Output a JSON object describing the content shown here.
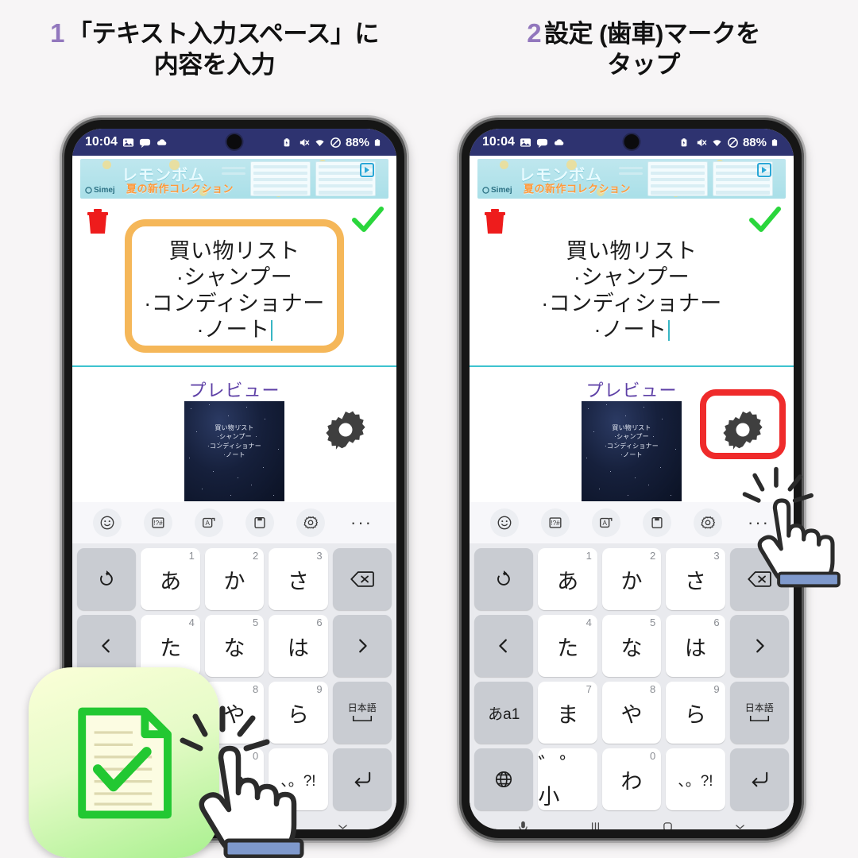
{
  "steps": [
    {
      "num": "1",
      "line1": "「テキスト入力スペース」に",
      "line2": "内容を入力"
    },
    {
      "num": "2",
      "line1": "設定 (歯車)マークを",
      "line2": "タップ"
    }
  ],
  "phone": {
    "statusbar": {
      "time": "10:04",
      "battery": "88%",
      "left_icons": [
        "gallery-icon",
        "message-icon",
        "cloud-icon"
      ],
      "right_icons": [
        "battery-saver-icon",
        "mute-icon",
        "wifi-icon",
        "dnd-icon"
      ]
    },
    "ad": {
      "title": "レモンボム",
      "subtitle": "夏の新作コレクション",
      "brand": "Simej",
      "play_icon": "play-icon"
    },
    "editor": {
      "trash_icon": "trash-icon",
      "confirm_icon": "check-icon",
      "lines": [
        "買い物リスト",
        "·シャンプー",
        "·コンディショナー",
        "·ノート"
      ],
      "caret": "text-caret",
      "underline_color": "#3ec3cf",
      "highlight_color": "#f5b759"
    },
    "preview": {
      "label": "プレビュー",
      "thumb_lines": [
        "買い物リスト",
        "·シャンプー",
        "·コンディショナー",
        "·ノート"
      ],
      "gear_icon": "gear-icon",
      "ring_color": "#ef2b2b"
    },
    "kbtoolbar": [
      {
        "icon": "emoji-icon"
      },
      {
        "icon": "symbols-icon",
        "label": "!?#"
      },
      {
        "icon": "translate-icon",
        "label": "A"
      },
      {
        "icon": "clipboard-icon"
      },
      {
        "icon": "settings-gear-icon"
      },
      {
        "icon": "more-icon",
        "label": "···"
      }
    ],
    "keyboard": {
      "rows": [
        [
          {
            "label": "",
            "icon": "undo-icon",
            "fn": true
          },
          {
            "label": "あ",
            "num": "1"
          },
          {
            "label": "か",
            "num": "2"
          },
          {
            "label": "さ",
            "num": "3"
          },
          {
            "label": "",
            "icon": "backspace-icon",
            "fn": true
          }
        ],
        [
          {
            "label": "",
            "icon": "cursor-left-icon",
            "fn": true
          },
          {
            "label": "た",
            "num": "4"
          },
          {
            "label": "な",
            "num": "5"
          },
          {
            "label": "は",
            "num": "6"
          },
          {
            "label": "",
            "icon": "cursor-right-icon",
            "fn": true
          }
        ],
        [
          {
            "label": "あa1",
            "fn": true,
            "small": true
          },
          {
            "label": "ま",
            "num": "7"
          },
          {
            "label": "や",
            "num": "8"
          },
          {
            "label": "ら",
            "num": "9"
          },
          {
            "label": "日本語",
            "icon": "space-icon",
            "fn": true,
            "tiny": true
          }
        ],
        [
          {
            "label": "",
            "icon": "globe-icon",
            "fn": true
          },
          {
            "label": "゛゜小"
          },
          {
            "label": "わ",
            "num": "0"
          },
          {
            "label": "、。?!"
          },
          {
            "label": "",
            "icon": "enter-icon",
            "fn": true
          }
        ]
      ]
    },
    "navbar": [
      {
        "icon": "mic-icon"
      },
      {
        "icon": "recents-icon"
      },
      {
        "icon": "home-icon"
      },
      {
        "icon": "hide-keyboard-icon"
      }
    ]
  },
  "overlays": {
    "app_icon": {
      "name": "note-checklist-app-icon",
      "color": "#22c832"
    },
    "tap_hand_left": "tap-hand-icon",
    "tap_hand_right": "tap-hand-icon"
  },
  "colors": {
    "page_bg": "#f7f5f6",
    "step_number": "#9277bd",
    "status_bar": "#2e3370",
    "preview_label": "#5d3fa6",
    "highlight_orange": "#f5b759",
    "highlight_red": "#ef2b2b",
    "check_green": "#2ad63c",
    "trash_red": "#ee1c1c"
  }
}
